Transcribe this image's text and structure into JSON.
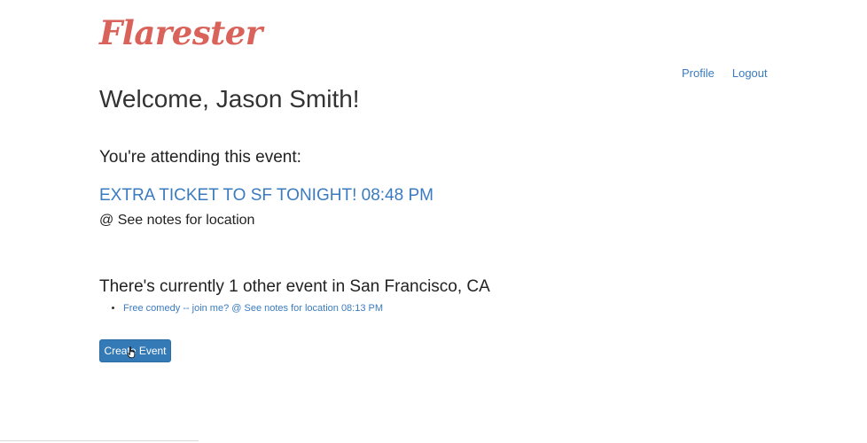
{
  "brand": {
    "logo_text": "Flarester",
    "logo_color": "#d9625a"
  },
  "nav": {
    "profile_label": "Profile",
    "logout_label": "Logout"
  },
  "welcome": {
    "text": "Welcome, Jason Smith!"
  },
  "attending": {
    "heading": "You're attending this event:",
    "event_title": "EXTRA TICKET TO SF TONIGHT! 08:48 PM",
    "event_location": "@ See notes for location"
  },
  "other_events": {
    "heading": "There's currently 1 other event in San Francisco, CA",
    "items": [
      {
        "label": "Free comedy -- join me? @ See notes for location 08:13 PM"
      }
    ]
  },
  "actions": {
    "create_event_label": "Create Event"
  },
  "colors": {
    "link": "#3a7bbf",
    "button": "#337ab7"
  },
  "icons": {
    "cursor": "hand-pointer-icon"
  }
}
